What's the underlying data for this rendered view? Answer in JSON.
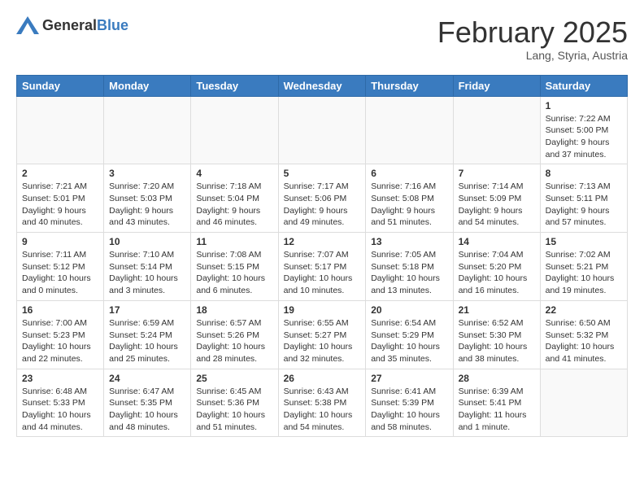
{
  "header": {
    "logo_general": "General",
    "logo_blue": "Blue",
    "month_year": "February 2025",
    "location": "Lang, Styria, Austria"
  },
  "weekdays": [
    "Sunday",
    "Monday",
    "Tuesday",
    "Wednesday",
    "Thursday",
    "Friday",
    "Saturday"
  ],
  "weeks": [
    [
      {
        "day": "",
        "info": ""
      },
      {
        "day": "",
        "info": ""
      },
      {
        "day": "",
        "info": ""
      },
      {
        "day": "",
        "info": ""
      },
      {
        "day": "",
        "info": ""
      },
      {
        "day": "",
        "info": ""
      },
      {
        "day": "1",
        "info": "Sunrise: 7:22 AM\nSunset: 5:00 PM\nDaylight: 9 hours and 37 minutes."
      }
    ],
    [
      {
        "day": "2",
        "info": "Sunrise: 7:21 AM\nSunset: 5:01 PM\nDaylight: 9 hours and 40 minutes."
      },
      {
        "day": "3",
        "info": "Sunrise: 7:20 AM\nSunset: 5:03 PM\nDaylight: 9 hours and 43 minutes."
      },
      {
        "day": "4",
        "info": "Sunrise: 7:18 AM\nSunset: 5:04 PM\nDaylight: 9 hours and 46 minutes."
      },
      {
        "day": "5",
        "info": "Sunrise: 7:17 AM\nSunset: 5:06 PM\nDaylight: 9 hours and 49 minutes."
      },
      {
        "day": "6",
        "info": "Sunrise: 7:16 AM\nSunset: 5:08 PM\nDaylight: 9 hours and 51 minutes."
      },
      {
        "day": "7",
        "info": "Sunrise: 7:14 AM\nSunset: 5:09 PM\nDaylight: 9 hours and 54 minutes."
      },
      {
        "day": "8",
        "info": "Sunrise: 7:13 AM\nSunset: 5:11 PM\nDaylight: 9 hours and 57 minutes."
      }
    ],
    [
      {
        "day": "9",
        "info": "Sunrise: 7:11 AM\nSunset: 5:12 PM\nDaylight: 10 hours and 0 minutes."
      },
      {
        "day": "10",
        "info": "Sunrise: 7:10 AM\nSunset: 5:14 PM\nDaylight: 10 hours and 3 minutes."
      },
      {
        "day": "11",
        "info": "Sunrise: 7:08 AM\nSunset: 5:15 PM\nDaylight: 10 hours and 6 minutes."
      },
      {
        "day": "12",
        "info": "Sunrise: 7:07 AM\nSunset: 5:17 PM\nDaylight: 10 hours and 10 minutes."
      },
      {
        "day": "13",
        "info": "Sunrise: 7:05 AM\nSunset: 5:18 PM\nDaylight: 10 hours and 13 minutes."
      },
      {
        "day": "14",
        "info": "Sunrise: 7:04 AM\nSunset: 5:20 PM\nDaylight: 10 hours and 16 minutes."
      },
      {
        "day": "15",
        "info": "Sunrise: 7:02 AM\nSunset: 5:21 PM\nDaylight: 10 hours and 19 minutes."
      }
    ],
    [
      {
        "day": "16",
        "info": "Sunrise: 7:00 AM\nSunset: 5:23 PM\nDaylight: 10 hours and 22 minutes."
      },
      {
        "day": "17",
        "info": "Sunrise: 6:59 AM\nSunset: 5:24 PM\nDaylight: 10 hours and 25 minutes."
      },
      {
        "day": "18",
        "info": "Sunrise: 6:57 AM\nSunset: 5:26 PM\nDaylight: 10 hours and 28 minutes."
      },
      {
        "day": "19",
        "info": "Sunrise: 6:55 AM\nSunset: 5:27 PM\nDaylight: 10 hours and 32 minutes."
      },
      {
        "day": "20",
        "info": "Sunrise: 6:54 AM\nSunset: 5:29 PM\nDaylight: 10 hours and 35 minutes."
      },
      {
        "day": "21",
        "info": "Sunrise: 6:52 AM\nSunset: 5:30 PM\nDaylight: 10 hours and 38 minutes."
      },
      {
        "day": "22",
        "info": "Sunrise: 6:50 AM\nSunset: 5:32 PM\nDaylight: 10 hours and 41 minutes."
      }
    ],
    [
      {
        "day": "23",
        "info": "Sunrise: 6:48 AM\nSunset: 5:33 PM\nDaylight: 10 hours and 44 minutes."
      },
      {
        "day": "24",
        "info": "Sunrise: 6:47 AM\nSunset: 5:35 PM\nDaylight: 10 hours and 48 minutes."
      },
      {
        "day": "25",
        "info": "Sunrise: 6:45 AM\nSunset: 5:36 PM\nDaylight: 10 hours and 51 minutes."
      },
      {
        "day": "26",
        "info": "Sunrise: 6:43 AM\nSunset: 5:38 PM\nDaylight: 10 hours and 54 minutes."
      },
      {
        "day": "27",
        "info": "Sunrise: 6:41 AM\nSunset: 5:39 PM\nDaylight: 10 hours and 58 minutes."
      },
      {
        "day": "28",
        "info": "Sunrise: 6:39 AM\nSunset: 5:41 PM\nDaylight: 11 hours and 1 minute."
      },
      {
        "day": "",
        "info": ""
      }
    ]
  ]
}
